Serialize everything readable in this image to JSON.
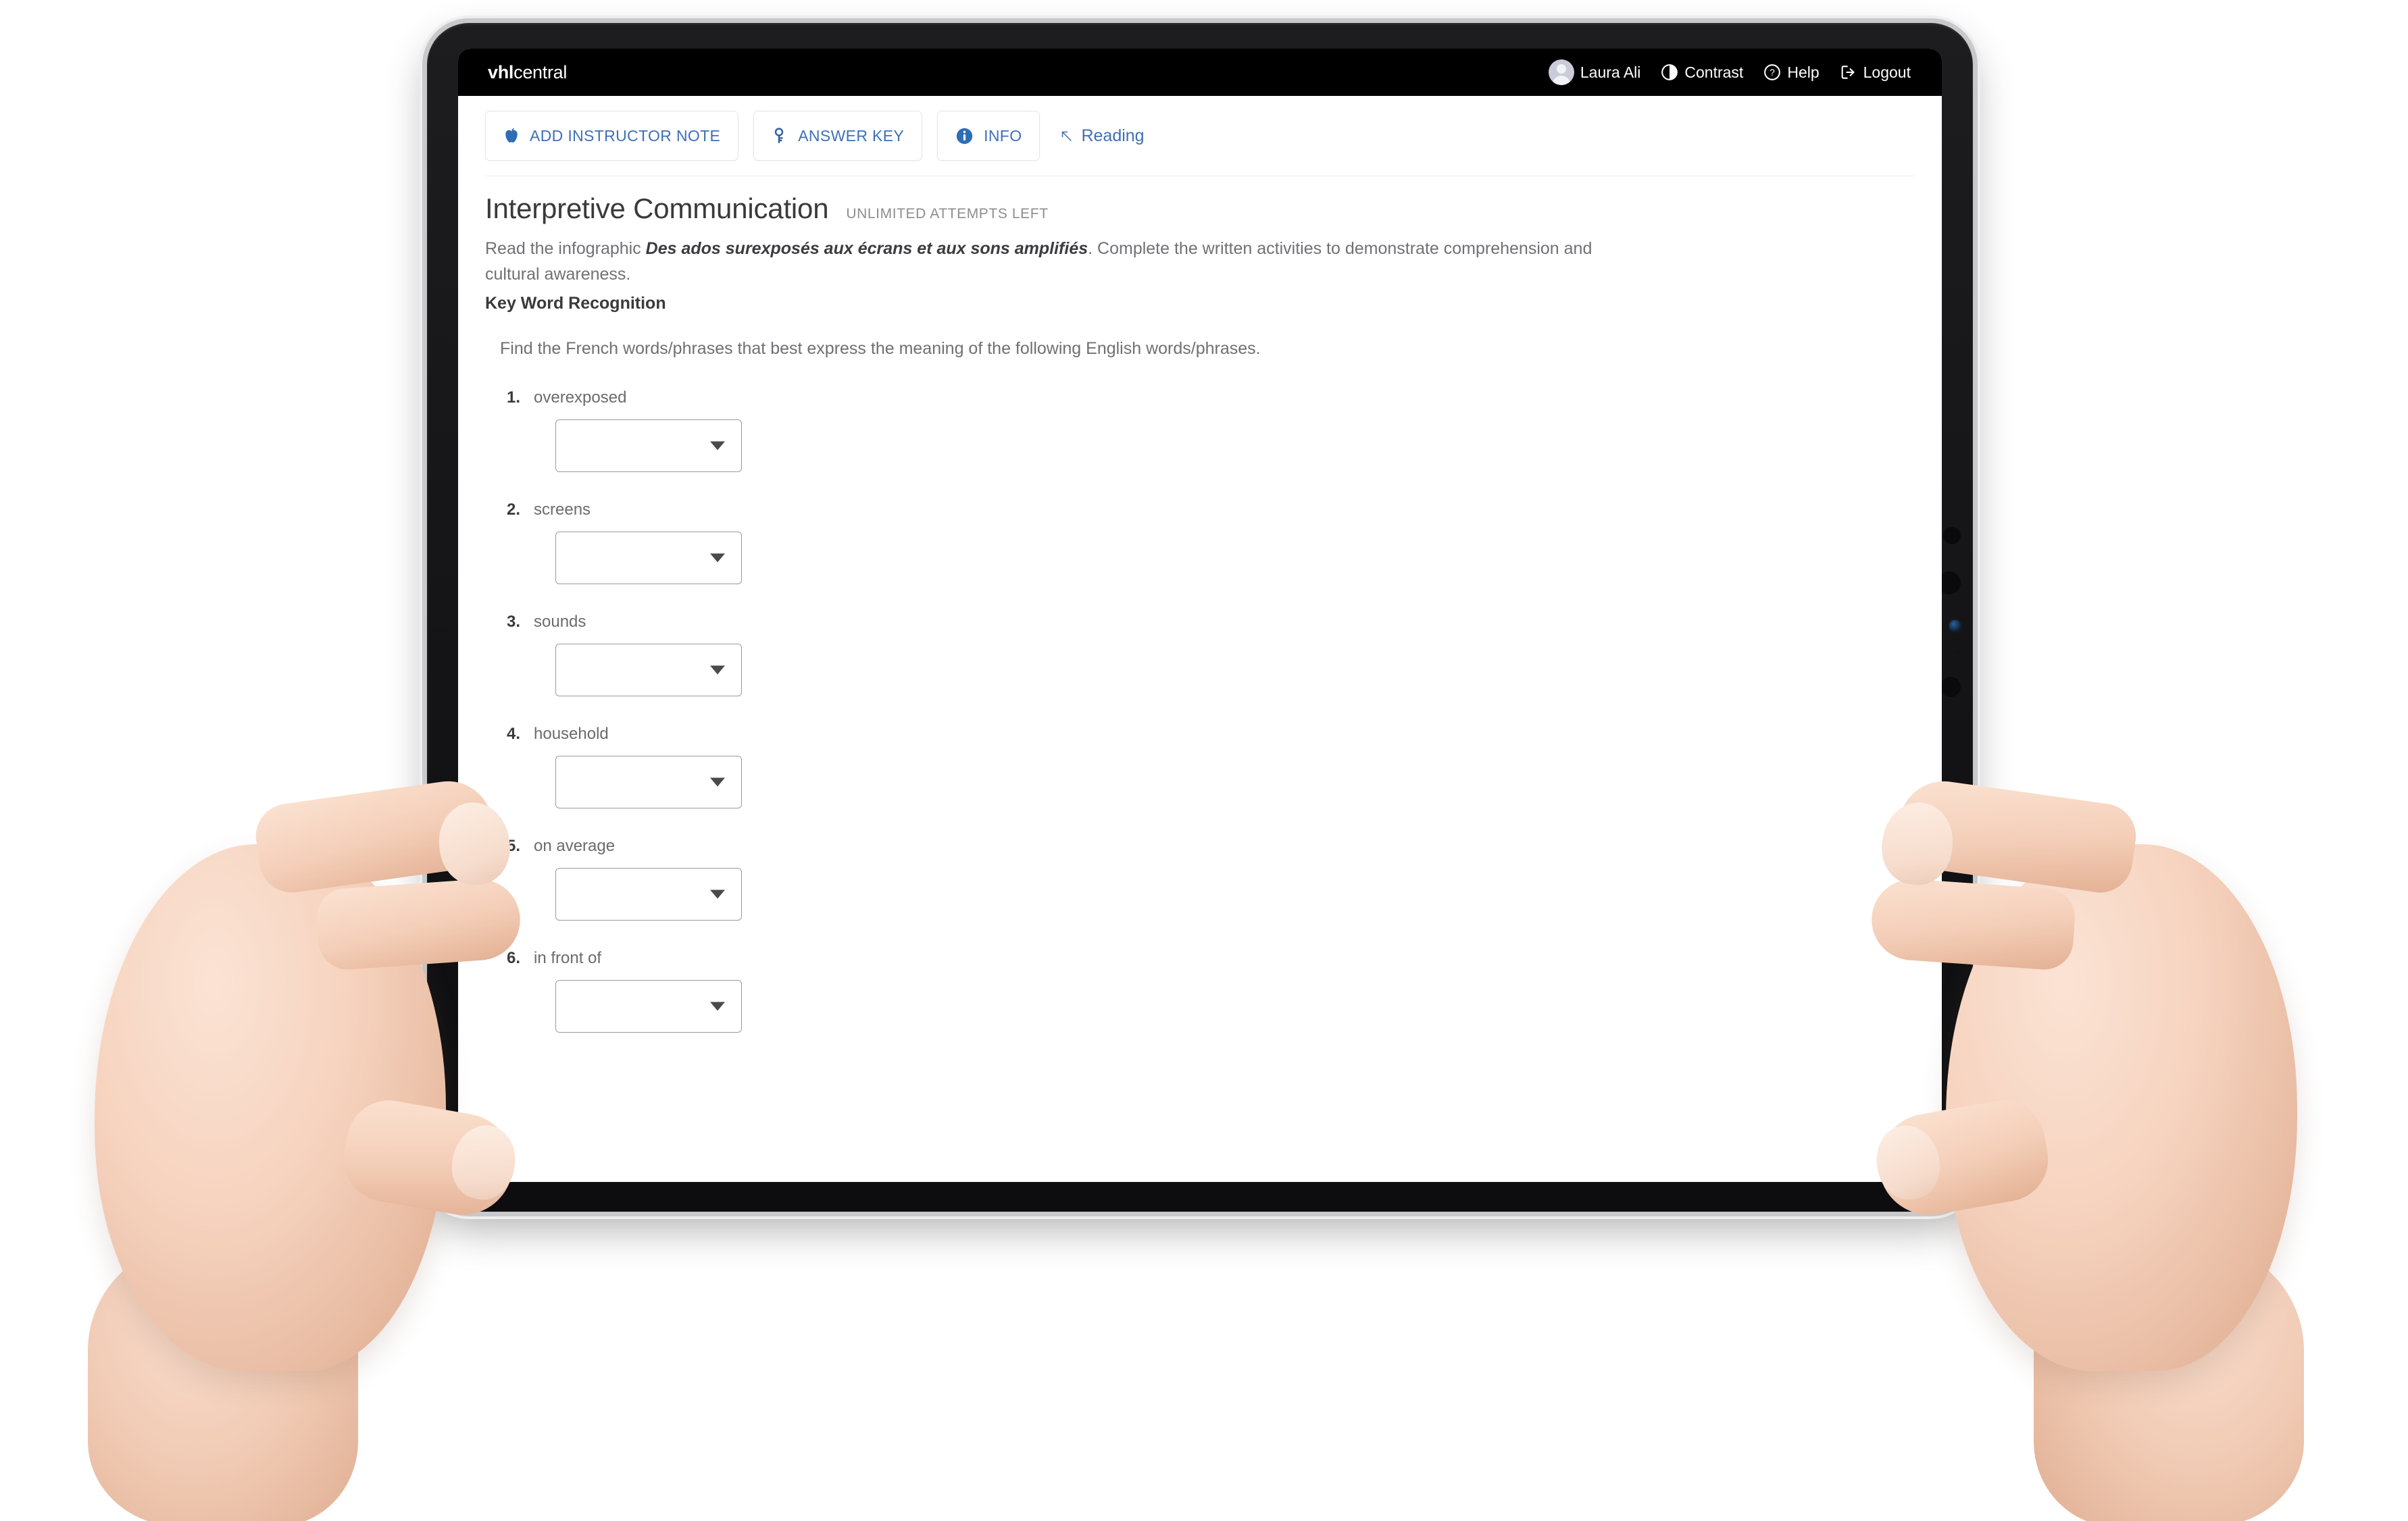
{
  "brand": {
    "logo_bold": "vhl",
    "logo_light": "central"
  },
  "topnav": {
    "user_name": "Laura Ali",
    "contrast_label": "Contrast",
    "help_label": "Help",
    "logout_label": "Logout"
  },
  "toolbar": {
    "add_instructor_note": "ADD INSTRUCTOR NOTE",
    "answer_key": "ANSWER KEY",
    "info": "INFO",
    "reading_link": "Reading"
  },
  "activity": {
    "title": "Interpretive Communication",
    "attempts": "UNLIMITED ATTEMPTS LEFT",
    "directions_pre": "Read the infographic ",
    "directions_french_title": "Des ados surexposés aux écrans et aux sons amplifiés",
    "directions_post": ". Complete the written activities to demonstrate comprehension and cultural awareness.",
    "section_heading": "Key Word Recognition",
    "prompt": "Find the French words/phrases that best express the meaning of the following English words/phrases."
  },
  "questions": [
    {
      "number": "1.",
      "label": "overexposed",
      "answer": ""
    },
    {
      "number": "2.",
      "label": "screens",
      "answer": ""
    },
    {
      "number": "3.",
      "label": "sounds",
      "answer": ""
    },
    {
      "number": "4.",
      "label": "household",
      "answer": ""
    },
    {
      "number": "5.",
      "label": "on average",
      "answer": ""
    },
    {
      "number": "6.",
      "label": "in front of",
      "answer": ""
    }
  ],
  "colors": {
    "topbar_background": "#000000",
    "link_blue": "#3f6fb5",
    "title_gray": "#3a3a3c",
    "body_gray": "#707076",
    "select_border": "#9a9a9e",
    "page_background": "#ffffff"
  }
}
